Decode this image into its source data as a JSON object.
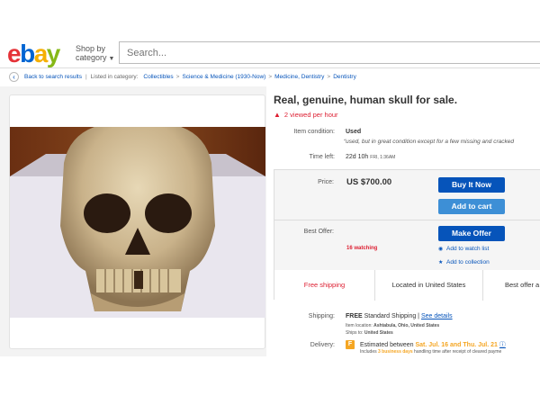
{
  "header": {
    "logo": {
      "e": "e",
      "b": "b",
      "a": "a",
      "y": "y"
    },
    "shop_by_line1": "Shop by",
    "shop_by_line2": "category",
    "search_placeholder": "Search..."
  },
  "breadcrumb": {
    "back_label": "Back to search results",
    "listed_in": "Listed in category:",
    "items": [
      "Collectibles",
      "Science & Medicine (1930-Now)",
      "Medicine, Dentistry",
      "Dentistry"
    ]
  },
  "listing": {
    "title": "Real, genuine, human skull for sale.",
    "viewed": "2 viewed per hour",
    "condition_label": "Item condition:",
    "condition_value": "Used",
    "condition_note": "used, but in great condition except for a few missing and cracked",
    "time_left_label": "Time left:",
    "time_left_value": "22d 10h",
    "time_left_detail": "FRI, 1:36AM",
    "price_label": "Price:",
    "price_value": "US $700.00",
    "buy_now": "Buy It Now",
    "add_to_cart": "Add to cart",
    "best_offer_label": "Best Offer:",
    "make_offer": "Make Offer",
    "watching": "16 watching",
    "add_to_watch": "Add to watch list",
    "add_to_collection": "Add to collection",
    "tabs": [
      "Free shipping",
      "Located in United States",
      "Best offer a"
    ]
  },
  "shipping": {
    "label": "Shipping:",
    "free": "FREE",
    "standard": "Standard Shipping",
    "see_details": "See details",
    "item_location_label": "Item location:",
    "item_location": "Ashtabula, Ohio, United States",
    "ships_to_label": "Ships to:",
    "ships_to": "United States"
  },
  "delivery": {
    "label": "Delivery:",
    "estimated": "Estimated between",
    "dates": "Sat. Jul. 16 and Thu. Jul. 21",
    "includes": "Includes",
    "business_days": "3 business days",
    "handling": "handling time after receipt of cleared payme"
  },
  "colors": {
    "brand_red": "#e53238",
    "brand_blue": "#0064d2",
    "brand_yellow": "#f5af02",
    "brand_green": "#86b817",
    "button_blue": "#0654ba",
    "alert_red": "#dd1e31"
  }
}
